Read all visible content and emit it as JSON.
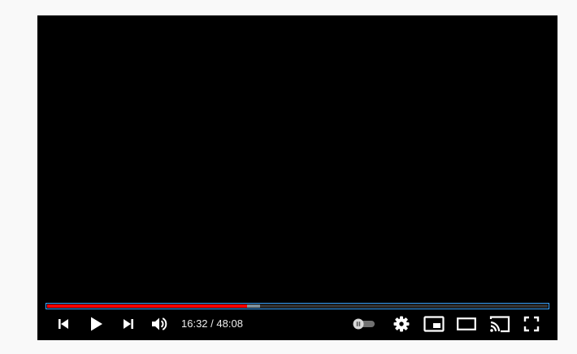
{
  "player": {
    "progress": {
      "played_fraction": 0.4,
      "buffered_fraction": 0.425,
      "played_color": "#ff0000",
      "focus_outline_color": "#3ea6ff"
    },
    "time": {
      "current": "16:32",
      "separator": " / ",
      "duration": "48:08"
    },
    "controls": {
      "left": [
        {
          "name": "previous-icon"
        },
        {
          "name": "play-icon"
        },
        {
          "name": "next-icon"
        },
        {
          "name": "volume-icon"
        }
      ],
      "right": [
        {
          "name": "autoplay-toggle-icon",
          "state": "off"
        },
        {
          "name": "gear-icon"
        },
        {
          "name": "miniplayer-icon"
        },
        {
          "name": "theater-mode-icon"
        },
        {
          "name": "cast-icon"
        },
        {
          "name": "fullscreen-icon"
        }
      ]
    }
  }
}
